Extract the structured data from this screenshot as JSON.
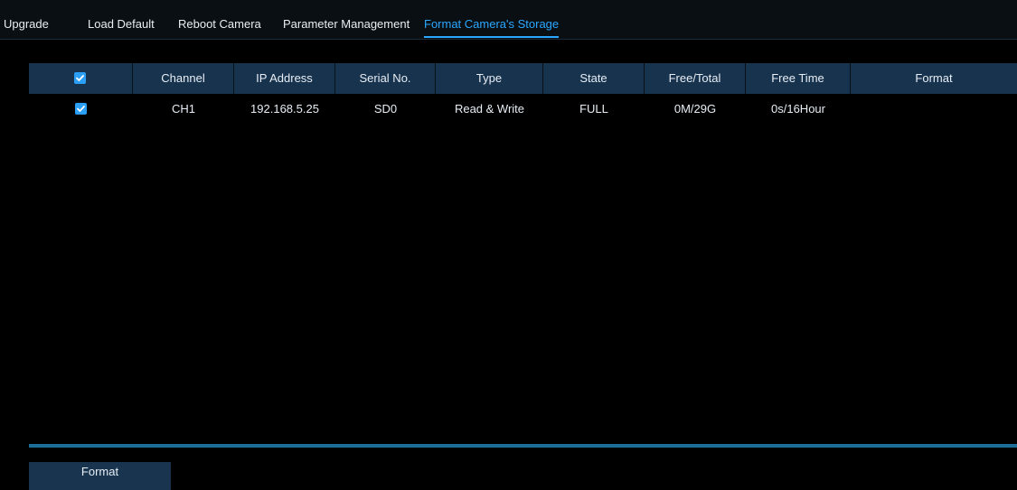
{
  "tabs": [
    {
      "label": "Upgrade",
      "active": false
    },
    {
      "label": "Load Default",
      "active": false
    },
    {
      "label": "Reboot Camera",
      "active": false
    },
    {
      "label": "Parameter Management",
      "active": false
    },
    {
      "label": "Format Camera's Storage",
      "active": true
    }
  ],
  "table": {
    "headers": [
      "",
      "Channel",
      "IP Address",
      "Serial No.",
      "Type",
      "State",
      "Free/Total",
      "Free Time",
      "Format"
    ],
    "select_all_checked": true,
    "rows": [
      {
        "checked": true,
        "channel": "CH1",
        "ip_address": "192.168.5.25",
        "serial_no": "SD0",
        "type": "Read & Write",
        "state": "FULL",
        "free_total": "0M/29G",
        "free_time": "0s/16Hour",
        "format": ""
      }
    ]
  },
  "footer": {
    "format_button_label": "Format"
  },
  "colors": {
    "accent": "#2aa8ff",
    "header_bg": "#17334e",
    "checkbox": "#2b9ef5",
    "background": "#000000"
  }
}
